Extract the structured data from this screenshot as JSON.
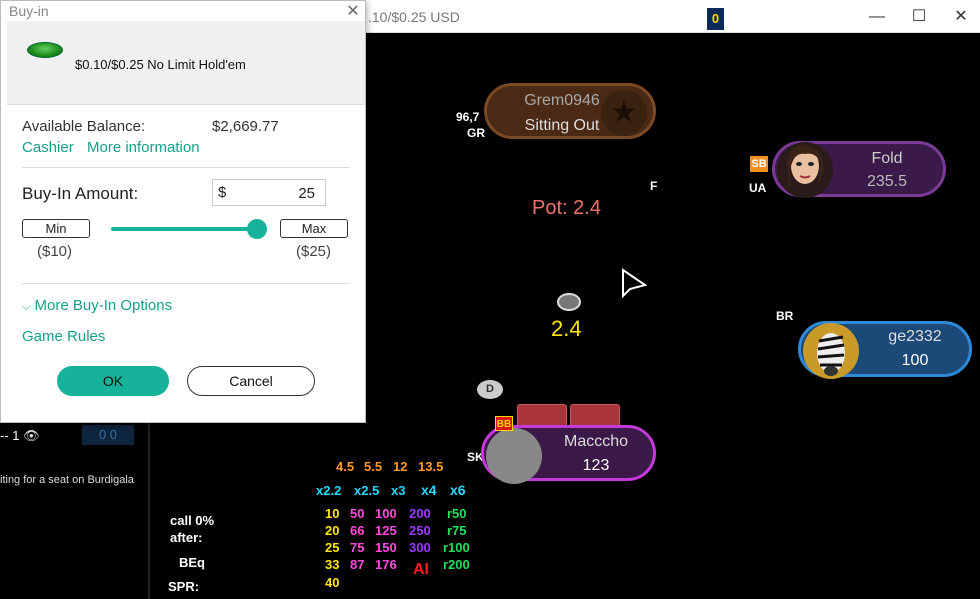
{
  "window": {
    "title_fragment": ".10/$0.25 USD",
    "badge": "0",
    "controls": {
      "minimize": "—",
      "maximize": "☐",
      "close": "✕"
    }
  },
  "left_panel": {
    "status_prefix": "-- 1",
    "waiting_text": "iting for a seat on Burdigala",
    "blue_box": "0 0"
  },
  "dialog": {
    "title": "Buy-in",
    "game": "$0.10/$0.25 No Limit Hold'em",
    "balance_label": "Available Balance:",
    "balance_value": "$2,669.77",
    "cashier": "Cashier",
    "more_info": "More information",
    "buyin_label": "Buy-In Amount:",
    "currency": "$",
    "amount": "25",
    "min_label": "Min",
    "max_label": "Max",
    "min_value": "($10)",
    "max_value": "($25)",
    "slider_fraction": 1.0,
    "more_options": "More Buy-In Options",
    "game_rules": "Game Rules",
    "ok": "OK",
    "cancel": "Cancel"
  },
  "table": {
    "pot_label": "Pot: 2.4",
    "pot_chip_value": "2.4",
    "dealer": "D",
    "seats": {
      "grem": {
        "name": "Grem0946",
        "status": "Sitting Out",
        "tag1": "96,7",
        "tag2": "GR"
      },
      "fold": {
        "name": "Fold",
        "stack": "235.5",
        "tag": "UA",
        "position": "SB",
        "side_tag": "F"
      },
      "ge": {
        "name": "ge2332",
        "stack": "100",
        "tag": "BR"
      },
      "hero": {
        "name": "Macccho",
        "stack": "123",
        "tag": "SK",
        "position": "BB"
      }
    }
  },
  "hud": {
    "bet_sizes": [
      "4.5",
      "5.5",
      "12",
      "13.5"
    ],
    "multipliers": [
      "x2.2",
      "x2.5",
      "x3",
      "x4",
      "x6"
    ],
    "call_label": "call 0%",
    "after_label": "after:",
    "beq_label": "BEq",
    "spr_label": "SPR:",
    "rows": [
      [
        "10",
        "50",
        "100",
        "200",
        "r50"
      ],
      [
        "20",
        "66",
        "125",
        "250",
        "r75"
      ],
      [
        "25",
        "75",
        "150",
        "300",
        "r100"
      ],
      [
        "33",
        "87",
        "176",
        "AI",
        "r200"
      ],
      [
        "40"
      ]
    ],
    "colors": {
      "yellow": "#ffe600",
      "magenta": "#ff4adf",
      "purple": "#9b3aff",
      "green": "#22e05a",
      "red": "#ff1a1a",
      "orange": "#ff9a2a",
      "cyan": "#22d8ff"
    }
  }
}
